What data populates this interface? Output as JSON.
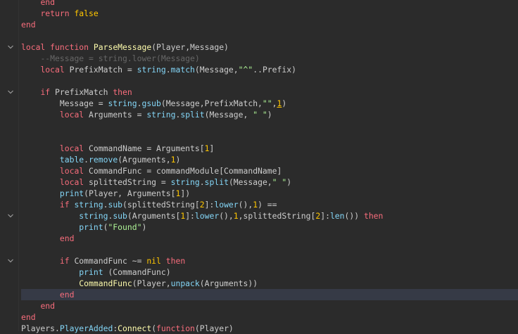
{
  "gutter": {
    "fold_icon": "chevron-down-icon",
    "fold_line_numbers": [
      4,
      8,
      19,
      23
    ]
  },
  "lines": [
    [
      {
        "t": "    ",
        "c": "p"
      },
      {
        "t": "end",
        "c": "k"
      }
    ],
    [
      {
        "t": "    ",
        "c": "p"
      },
      {
        "t": "return",
        "c": "k"
      },
      {
        "t": " ",
        "c": "p"
      },
      {
        "t": "false",
        "c": "b"
      }
    ],
    [
      {
        "t": "end",
        "c": "k"
      }
    ],
    [],
    [
      {
        "t": "local",
        "c": "k"
      },
      {
        "t": " ",
        "c": "p"
      },
      {
        "t": "function",
        "c": "k"
      },
      {
        "t": " ",
        "c": "p"
      },
      {
        "t": "ParseMessage",
        "c": "f"
      },
      {
        "t": "(Player,Message)",
        "c": "p"
      }
    ],
    [
      {
        "t": "    ",
        "c": "p"
      },
      {
        "t": "--Message = string.lower(Message)",
        "c": "c"
      }
    ],
    [
      {
        "t": "    ",
        "c": "p"
      },
      {
        "t": "local",
        "c": "k"
      },
      {
        "t": " PrefixMatch = ",
        "c": "p"
      },
      {
        "t": "string",
        "c": "bi"
      },
      {
        "t": ".",
        "c": "p"
      },
      {
        "t": "match",
        "c": "bi"
      },
      {
        "t": "(Message,",
        "c": "p"
      },
      {
        "t": "\"^\"",
        "c": "s"
      },
      {
        "t": "..Prefix)",
        "c": "p"
      }
    ],
    [],
    [
      {
        "t": "    ",
        "c": "p"
      },
      {
        "t": "if",
        "c": "k"
      },
      {
        "t": " PrefixMatch ",
        "c": "p"
      },
      {
        "t": "then",
        "c": "k"
      }
    ],
    [
      {
        "t": "        Message = ",
        "c": "p"
      },
      {
        "t": "string",
        "c": "bi"
      },
      {
        "t": ".",
        "c": "p"
      },
      {
        "t": "gsub",
        "c": "bi"
      },
      {
        "t": "(Message,PrefixMatch,",
        "c": "p"
      },
      {
        "t": "\"\"",
        "c": "s"
      },
      {
        "t": ",",
        "c": "p"
      },
      {
        "t": "1",
        "c": "n",
        "u": true
      },
      {
        "t": ")",
        "c": "p"
      }
    ],
    [
      {
        "t": "        ",
        "c": "p"
      },
      {
        "t": "local",
        "c": "k"
      },
      {
        "t": " Arguments = ",
        "c": "p"
      },
      {
        "t": "string",
        "c": "bi"
      },
      {
        "t": ".",
        "c": "p"
      },
      {
        "t": "split",
        "c": "bi"
      },
      {
        "t": "(Message, ",
        "c": "p"
      },
      {
        "t": "\" \"",
        "c": "s"
      },
      {
        "t": ")",
        "c": "p"
      }
    ],
    [],
    [],
    [
      {
        "t": "        ",
        "c": "p"
      },
      {
        "t": "local",
        "c": "k"
      },
      {
        "t": " CommandName = Arguments[",
        "c": "p"
      },
      {
        "t": "1",
        "c": "n"
      },
      {
        "t": "]",
        "c": "p"
      }
    ],
    [
      {
        "t": "        ",
        "c": "p"
      },
      {
        "t": "table",
        "c": "bi"
      },
      {
        "t": ".",
        "c": "p"
      },
      {
        "t": "remove",
        "c": "bi"
      },
      {
        "t": "(Arguments,",
        "c": "p"
      },
      {
        "t": "1",
        "c": "n"
      },
      {
        "t": ")",
        "c": "p"
      }
    ],
    [
      {
        "t": "        ",
        "c": "p"
      },
      {
        "t": "local",
        "c": "k"
      },
      {
        "t": " CommandFunc = commandModule[CommandName]",
        "c": "p"
      }
    ],
    [
      {
        "t": "        ",
        "c": "p"
      },
      {
        "t": "local",
        "c": "k"
      },
      {
        "t": " splittedString = ",
        "c": "p"
      },
      {
        "t": "string",
        "c": "bi"
      },
      {
        "t": ".",
        "c": "p"
      },
      {
        "t": "split",
        "c": "bi"
      },
      {
        "t": "(Message,",
        "c": "p"
      },
      {
        "t": "\" \"",
        "c": "s"
      },
      {
        "t": ")",
        "c": "p"
      }
    ],
    [
      {
        "t": "        ",
        "c": "p"
      },
      {
        "t": "print",
        "c": "bi"
      },
      {
        "t": "(Player, Arguments[",
        "c": "p"
      },
      {
        "t": "1",
        "c": "n"
      },
      {
        "t": "])",
        "c": "p"
      }
    ],
    [
      {
        "t": "        ",
        "c": "p"
      },
      {
        "t": "if",
        "c": "k"
      },
      {
        "t": " ",
        "c": "p"
      },
      {
        "t": "string",
        "c": "bi"
      },
      {
        "t": ".",
        "c": "p"
      },
      {
        "t": "sub",
        "c": "bi"
      },
      {
        "t": "(splittedString[",
        "c": "p"
      },
      {
        "t": "2",
        "c": "n"
      },
      {
        "t": "]:",
        "c": "p"
      },
      {
        "t": "lower",
        "c": "bi"
      },
      {
        "t": "(),",
        "c": "p"
      },
      {
        "t": "1",
        "c": "n"
      },
      {
        "t": ") ==",
        "c": "p"
      }
    ],
    [
      {
        "t": "            ",
        "c": "p"
      },
      {
        "t": "string",
        "c": "bi"
      },
      {
        "t": ".",
        "c": "p"
      },
      {
        "t": "sub",
        "c": "bi"
      },
      {
        "t": "(Arguments[",
        "c": "p"
      },
      {
        "t": "1",
        "c": "n"
      },
      {
        "t": "]:",
        "c": "p"
      },
      {
        "t": "lower",
        "c": "bi"
      },
      {
        "t": "(),",
        "c": "p"
      },
      {
        "t": "1",
        "c": "n"
      },
      {
        "t": ",splittedString[",
        "c": "p"
      },
      {
        "t": "2",
        "c": "n"
      },
      {
        "t": "]:",
        "c": "p"
      },
      {
        "t": "len",
        "c": "bi"
      },
      {
        "t": "()) ",
        "c": "p"
      },
      {
        "t": "then",
        "c": "k"
      }
    ],
    [
      {
        "t": "            ",
        "c": "p"
      },
      {
        "t": "print",
        "c": "bi"
      },
      {
        "t": "(",
        "c": "p"
      },
      {
        "t": "\"Found\"",
        "c": "s"
      },
      {
        "t": ")",
        "c": "p"
      }
    ],
    [
      {
        "t": "        ",
        "c": "p"
      },
      {
        "t": "end",
        "c": "k"
      }
    ],
    [],
    [
      {
        "t": "        ",
        "c": "p"
      },
      {
        "t": "if",
        "c": "k"
      },
      {
        "t": " CommandFunc ~= ",
        "c": "p"
      },
      {
        "t": "nil",
        "c": "b"
      },
      {
        "t": " ",
        "c": "p"
      },
      {
        "t": "then",
        "c": "k"
      }
    ],
    [
      {
        "t": "            ",
        "c": "p"
      },
      {
        "t": "print",
        "c": "bi"
      },
      {
        "t": " (CommandFunc)",
        "c": "p"
      }
    ],
    [
      {
        "t": "            ",
        "c": "p"
      },
      {
        "t": "CommandFunc",
        "c": "f"
      },
      {
        "t": "(Player,",
        "c": "p"
      },
      {
        "t": "unpack",
        "c": "bi"
      },
      {
        "t": "(Arguments))",
        "c": "p"
      }
    ],
    [
      {
        "t": "        ",
        "c": "p"
      },
      {
        "t": "end",
        "c": "k"
      }
    ],
    [
      {
        "t": "    ",
        "c": "p"
      },
      {
        "t": "end",
        "c": "k"
      }
    ],
    [
      {
        "t": "end",
        "c": "k"
      }
    ],
    [
      {
        "t": "Players",
        "c": "p"
      },
      {
        "t": ".",
        "c": "p"
      },
      {
        "t": "PlayerAdded",
        "c": "bi"
      },
      {
        "t": ":",
        "c": "p"
      },
      {
        "t": "Connect",
        "c": "f"
      },
      {
        "t": "(",
        "c": "p"
      },
      {
        "t": "function",
        "c": "k"
      },
      {
        "t": "(Player)",
        "c": "p"
      }
    ]
  ],
  "current_line": 26,
  "colors": {
    "background": "#2b2b2b",
    "current_line": "#363a46",
    "keyword": "#f86d7c",
    "builtin": "#84d6f7",
    "string": "#adf195",
    "number": "#ffc600",
    "comment": "#666666",
    "text": "#cccccc"
  }
}
